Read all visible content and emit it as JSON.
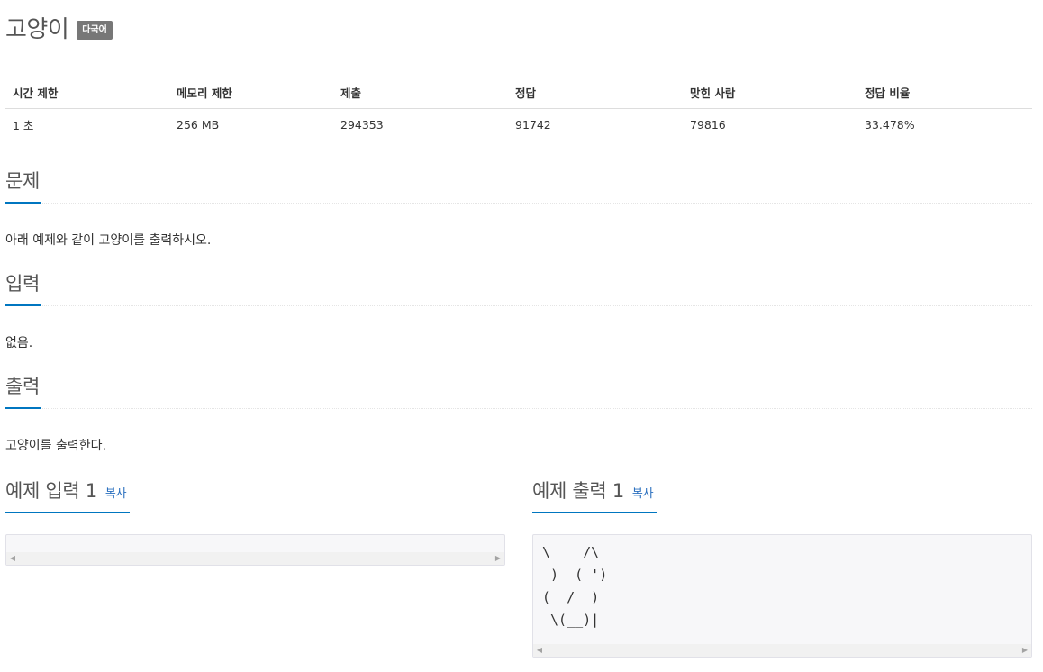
{
  "problem": {
    "title": "고양이",
    "language_badge": "다국어"
  },
  "info_table": {
    "headers": [
      "시간 제한",
      "메모리 제한",
      "제출",
      "정답",
      "맞힌 사람",
      "정답 비율"
    ],
    "values": [
      "1 초",
      "256 MB",
      "294353",
      "91742",
      "79816",
      "33.478%"
    ]
  },
  "sections": {
    "description": {
      "heading": "문제",
      "text": "아래 예제와 같이 고양이를 출력하시오."
    },
    "input": {
      "heading": "입력",
      "text": "없음."
    },
    "output": {
      "heading": "출력",
      "text": "고양이를 출력한다."
    }
  },
  "samples": {
    "input": {
      "heading": "예제 입력 1",
      "copy_label": "복사",
      "content": ""
    },
    "output": {
      "heading": "예제 출력 1",
      "copy_label": "복사",
      "content": "\\    /\\\n )  ( ')\n(  /  )\n \\(__)|"
    }
  },
  "icons": {
    "scroll_left": "scroll-left-arrow-icon",
    "scroll_right": "scroll-right-arrow-icon"
  },
  "colors": {
    "accent": "#0076c0",
    "link": "#2a6fbf",
    "badge_bg": "#777777",
    "code_bg": "#f7f7f9"
  }
}
